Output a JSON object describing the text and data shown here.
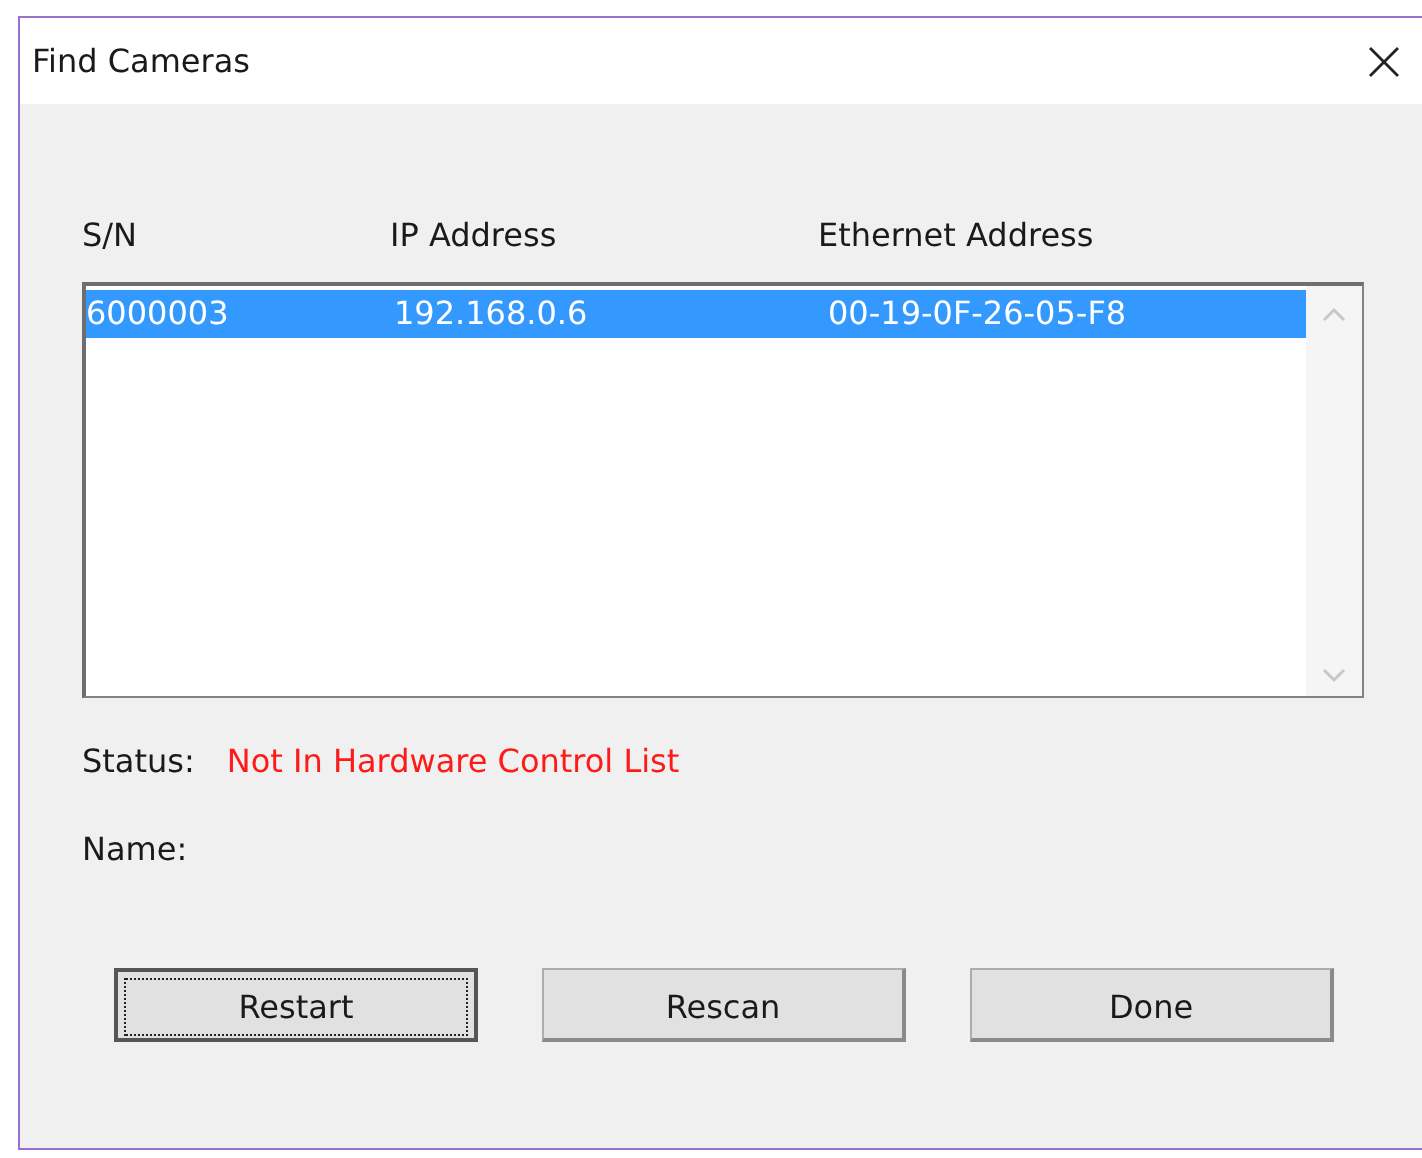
{
  "window": {
    "title": "Find Cameras"
  },
  "list": {
    "columns": [
      "S/N",
      "IP Address",
      "Ethernet Address"
    ],
    "rows": [
      {
        "cells": [
          "6000003",
          "192.168.0.6",
          "00-19-0F-26-05-F8"
        ],
        "selected": true
      }
    ]
  },
  "status": {
    "label": "Status:",
    "value": "Not In Hardware Control List"
  },
  "name": {
    "label": "Name:"
  },
  "buttons": [
    {
      "label": "Restart",
      "default": true
    },
    {
      "label": "Rescan",
      "default": false
    },
    {
      "label": "Done",
      "default": false
    }
  ]
}
